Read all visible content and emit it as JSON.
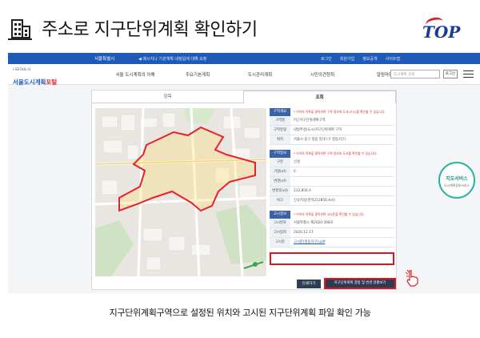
{
  "slide": {
    "title": "주소로 지구단위계획 확인하기",
    "logo_text": "TOP",
    "caption": "지구단위계획구역으로 설정된 위치와 고시된 지구단위계획 파일 확인 가능"
  },
  "site": {
    "gnb_top": {
      "seoul": "서울특별시",
      "notice": "◀ 메시지나 기관계획 내정됩에 대해 요청",
      "links": [
        "로그인",
        "회원가입",
        "정보공개",
        "사이트맵"
      ]
    },
    "logo_small": "i·SEOUL·U",
    "logo_blue": "서울도시계획",
    "logo_red": "포털",
    "menu": [
      "서울 도시계획의 이해",
      "주요기본계획",
      "도시관리계획",
      "시민의견청취",
      "알림마당"
    ],
    "search_placeholder": "도시계획 검색",
    "login_label": "로그인"
  },
  "tabs": [
    {
      "label": "항목",
      "active": false
    },
    {
      "label": "조회",
      "active": true
    }
  ],
  "info": {
    "zone": {
      "header": "구역개요",
      "note": "* 이하의 목록을 클릭하면 구역 정보와 도서(고시)를 확인할 수 있습니다.",
      "rows": [
        {
          "k": "구역명",
          "v": "미근지구단위계획구역"
        },
        {
          "k": "구역유형",
          "v": "내방추정(도시)지구단위계획 구역"
        },
        {
          "k": "위치",
          "v": "서울시 중구 정동 일대 (구 정동지구)"
        }
      ]
    },
    "area": {
      "header": "구역정보",
      "note": "* 이하의 목록을 클릭하면 구역 정보와 도서를 확인할 수 있습니다.",
      "rows": [
        {
          "k": "구분",
          "v": "신설"
        },
        {
          "k": "기정(㎡)",
          "v": "0"
        },
        {
          "k": "변경(㎡)",
          "v": "-"
        },
        {
          "k": "변경후(㎡)",
          "v": "212,856.4"
        },
        {
          "k": "비고",
          "v": "신규지정(면적212856.4㎡)"
        }
      ]
    },
    "notice": {
      "header": "고시정보",
      "note": "* 이하의 목록을 클릭하면 고시문을 확인할 수 있습니다.",
      "rows": [
        {
          "k": "고시번호",
          "v": "서울특별시 제2020-398호"
        },
        {
          "k": "고시일자",
          "v": "2020.12.17"
        },
        {
          "k": "고시문",
          "v": "고시문(정동지구).pdf"
        }
      ]
    },
    "buttons": {
      "print": "인쇄하기",
      "detail": "지구단위계획 결정 및 변경 현황보기"
    }
  },
  "side_badge": {
    "title": "지도서비스",
    "sub": "도시계획정보서비스"
  },
  "colors": {
    "brand_blue": "#1e5ab8",
    "highlight_red": "#e0141e",
    "zone_outline": "#e8202a"
  }
}
